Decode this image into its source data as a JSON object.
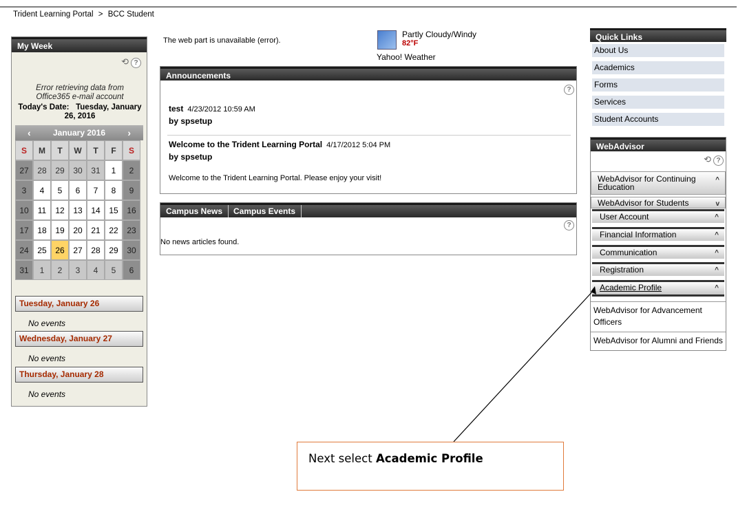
{
  "breadcrumb": {
    "root": "Trident Learning Portal",
    "separator": ">",
    "current": "BCC Student"
  },
  "my_week": {
    "title": "My Week",
    "error_line1": "Error retrieving data from",
    "error_line2": "Office365 e-mail account",
    "today_label": "Today's Date:",
    "today_value": "Tuesday, January",
    "today_value2": "26, 2016",
    "calendar": {
      "month": "January 2016",
      "prev": "‹",
      "next": "›",
      "weekdays": [
        "S",
        "M",
        "T",
        "W",
        "T",
        "F",
        "S"
      ],
      "weeks": [
        [
          "27",
          "28",
          "29",
          "30",
          "31",
          "1",
          "2"
        ],
        [
          "3",
          "4",
          "5",
          "6",
          "7",
          "8",
          "9"
        ],
        [
          "10",
          "11",
          "12",
          "13",
          "14",
          "15",
          "16"
        ],
        [
          "17",
          "18",
          "19",
          "20",
          "21",
          "22",
          "23"
        ],
        [
          "24",
          "25",
          "26",
          "27",
          "28",
          "29",
          "30"
        ],
        [
          "31",
          "1",
          "2",
          "3",
          "4",
          "5",
          "6"
        ]
      ]
    },
    "days": [
      {
        "label": "Tuesday, January 26",
        "events": "No events"
      },
      {
        "label": "Wednesday, January 27",
        "events": "No events"
      },
      {
        "label": "Thursday, January 28",
        "events": "No events"
      }
    ]
  },
  "center": {
    "webpart_error": "The web part is unavailable (error).",
    "weather": {
      "condition": "Partly Cloudy/Windy",
      "temp": "82°F",
      "source": "Yahoo! Weather"
    },
    "announcements": {
      "title": "Announcements",
      "items": [
        {
          "title": "test",
          "date": "4/23/2012 10:59 AM",
          "by": "by spsetup",
          "body": ""
        },
        {
          "title": "Welcome to the Trident Learning Portal",
          "date": "4/17/2012 5:04 PM",
          "by": "by spsetup",
          "body": "Welcome to the Trident Learning Portal.  Please enjoy your visit!"
        }
      ]
    },
    "news": {
      "tab1": "Campus News",
      "tab2": "Campus Events",
      "empty": "No news articles found."
    }
  },
  "quick_links": {
    "title": "Quick Links",
    "items": [
      "About Us",
      "Academics",
      "Forms",
      "Services",
      "Student Accounts"
    ]
  },
  "webadvisor": {
    "title": "WebAdvisor",
    "continuing": "WebAdvisor for Continuing Education",
    "students": "WebAdvisor for Students",
    "subs": [
      "User Account",
      "Financial Information",
      "Communication",
      "Registration",
      "Academic Profile"
    ],
    "advancement": "WebAdvisor for Advancement Officers",
    "alumni": "WebAdvisor for Alumni and Friends"
  },
  "callout": {
    "prefix": "Next select ",
    "bold": "Academic Profile",
    "border_color": "#e07a3a"
  }
}
